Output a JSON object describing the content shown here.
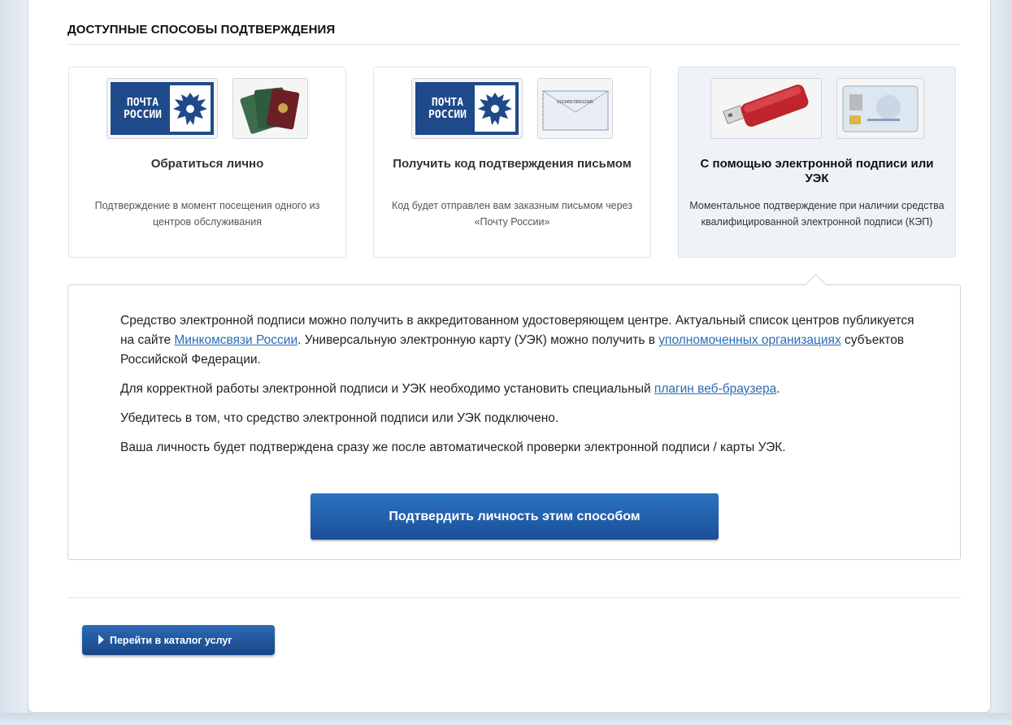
{
  "section": {
    "title": "ДОСТУПНЫЕ СПОСОБЫ ПОДТВЕРЖДЕНИЯ"
  },
  "brand": {
    "logo_line1": "ПОЧТА",
    "logo_line2": "РОССИИ"
  },
  "cards": [
    {
      "title": "Обратиться лично",
      "description": "Подтверждение в момент посещения одного из центров обслуживания",
      "icons": [
        "pochta-rossii-logo",
        "passport-icon"
      ],
      "selected": false
    },
    {
      "title": "Получить код подтверждения письмом",
      "description": "Код будет отправлен вам заказным письмом через «Почту России»",
      "icons": [
        "pochta-rossii-logo",
        "envelope-icon"
      ],
      "envelope_code": "0123456789012345",
      "selected": false
    },
    {
      "title": "С помощью электронной подписи или УЭК",
      "description": "Моментальное подтверждение при наличии средства квалифицированной электронной подписи (КЭП)",
      "icons": [
        "usb-token-icon",
        "uek-card-icon"
      ],
      "selected": true
    }
  ],
  "detail": {
    "p1_a": "Средство электронной подписи можно получить в аккредитованном удостоверяющем центре. Актуальный список центров публикуется на сайте ",
    "p1_link1": "Минкомсвязи России",
    "p1_b": ". Универсальную электронную карту (УЭК) можно получить в ",
    "p1_link2": "уполномоченных организациях",
    "p1_c": " субъектов Российской Федерации.",
    "p2_a": "Для корректной работы электронной подписи и УЭК необходимо установить специальный ",
    "p2_link": "плагин веб-браузера",
    "p2_b": ".",
    "p3": "Убедитесь в том, что средство электронной подписи или УЭК подключено.",
    "p4": "Ваша личность будет подтверждена сразу же после автоматической проверки электронной подписи / карты УЭК.",
    "confirm_button": "Подтвердить личность этим способом"
  },
  "footer": {
    "catalog_button": "Перейти в каталог услуг"
  },
  "colors": {
    "accent": "#1f5ba8",
    "link": "#2a6db2",
    "brand_blue": "#1f4a8a",
    "selected_card_bg": "#eff3f8"
  }
}
